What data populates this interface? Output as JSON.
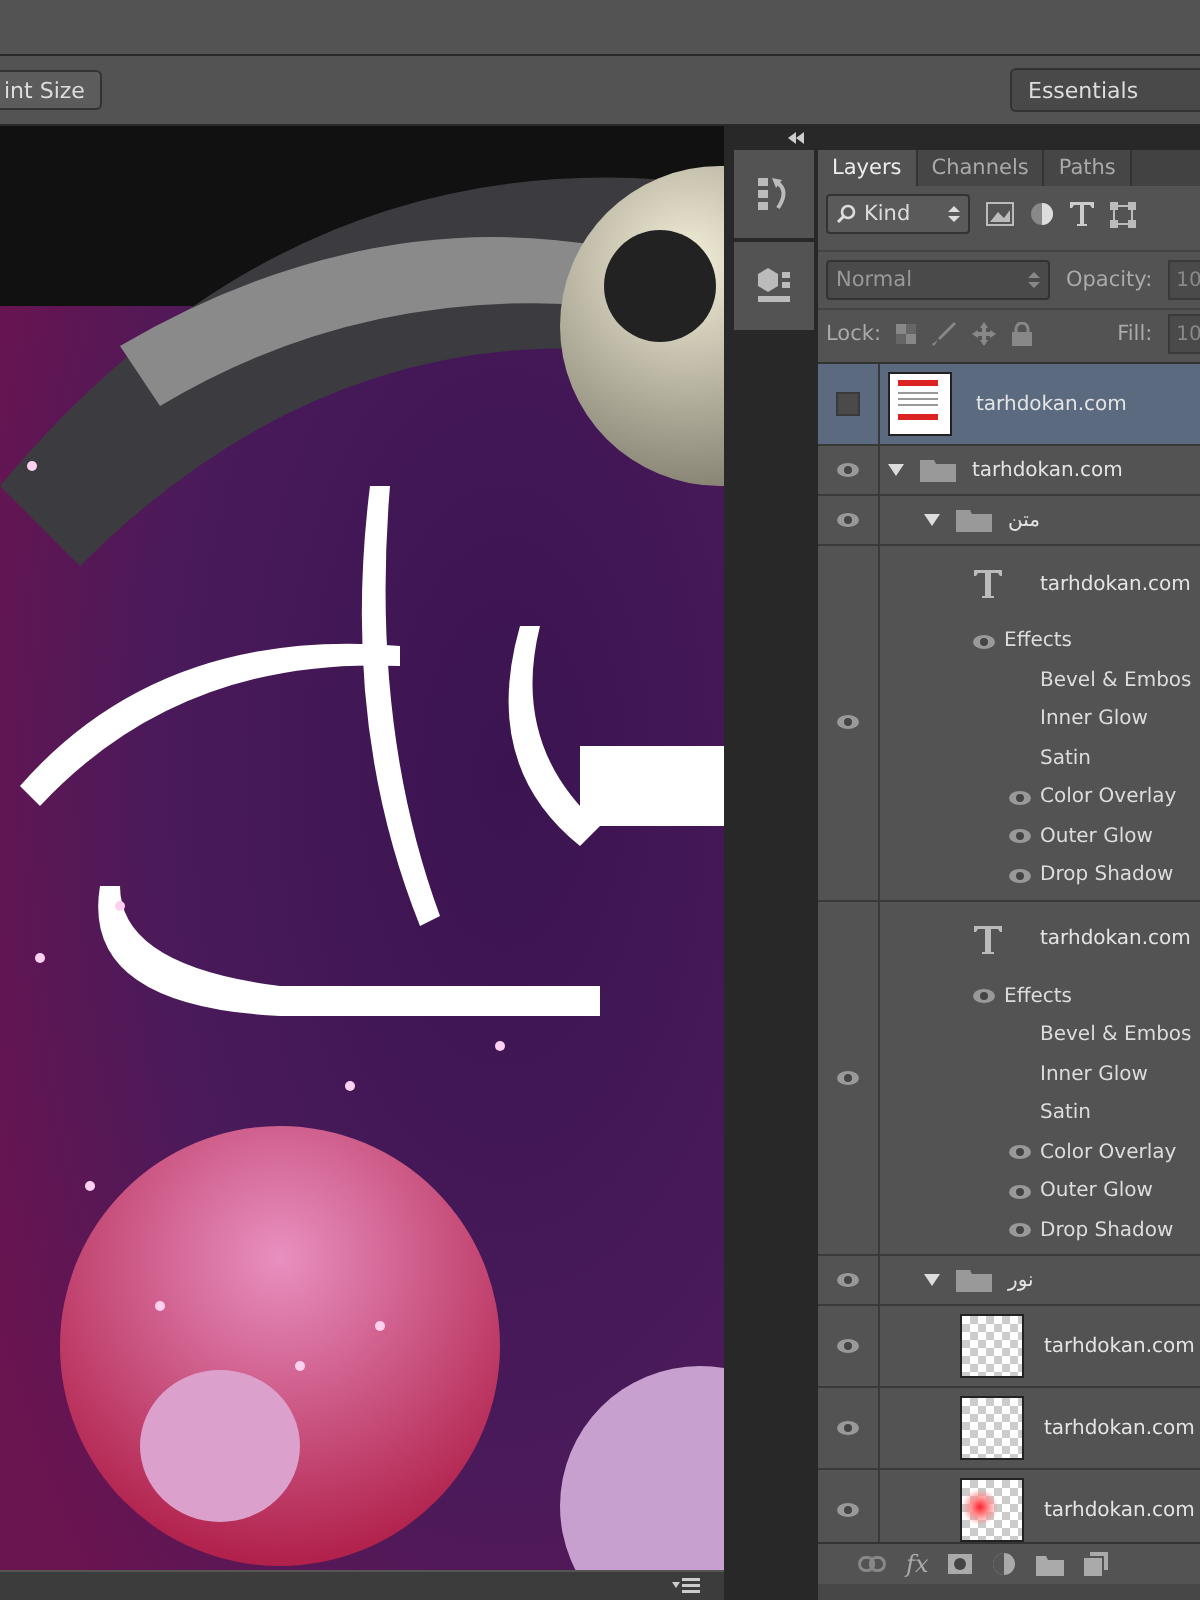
{
  "options_bar": {
    "button": "int Size",
    "workspace": "Essentials"
  },
  "layers_panel": {
    "tabs": [
      {
        "label": "Layers",
        "selected": true
      },
      {
        "label": "Channels",
        "selected": false
      },
      {
        "label": "Paths",
        "selected": false
      }
    ],
    "filter": "Kind",
    "blend_mode": "Normal",
    "opacity_label": "Opacity:",
    "opacity": "10",
    "lock_label": "Lock:",
    "fill_label": "Fill:",
    "fill": "10",
    "layers": [
      {
        "kind": "image",
        "name": "tarhdokan.com",
        "visible": false,
        "selected": true,
        "thumbnail": {
          "kind": "document"
        }
      },
      {
        "kind": "group",
        "name": "tarhdokan.com",
        "visible": true,
        "expanded": true,
        "selected": false,
        "children": [
          {
            "kind": "group",
            "name": "متن",
            "visible": true,
            "expanded": true,
            "selected": false,
            "children": [
              {
                "kind": "text",
                "name": "tarhdokan.com",
                "visible": true,
                "selected": false,
                "effects_label": "Effects",
                "effects_visible": true,
                "effects": [
                  {
                    "name": "Bevel & Embos",
                    "visible": false
                  },
                  {
                    "name": "Inner Glow",
                    "visible": false
                  },
                  {
                    "name": "Satin",
                    "visible": false
                  },
                  {
                    "name": "Color Overlay",
                    "visible": true
                  },
                  {
                    "name": "Outer Glow",
                    "visible": true
                  },
                  {
                    "name": "Drop Shadow",
                    "visible": true
                  }
                ]
              },
              {
                "kind": "text",
                "name": "tarhdokan.com",
                "visible": true,
                "selected": false,
                "effects_label": "Effects",
                "effects_visible": true,
                "effects": [
                  {
                    "name": "Bevel & Embos",
                    "visible": false
                  },
                  {
                    "name": "Inner Glow",
                    "visible": false
                  },
                  {
                    "name": "Satin",
                    "visible": false
                  },
                  {
                    "name": "Color Overlay",
                    "visible": true
                  },
                  {
                    "name": "Outer Glow",
                    "visible": true
                  },
                  {
                    "name": "Drop Shadow",
                    "visible": true
                  }
                ]
              }
            ]
          },
          {
            "kind": "group",
            "name": "نور",
            "visible": true,
            "expanded": true,
            "selected": false,
            "children": [
              {
                "kind": "image",
                "name": "tarhdokan.com",
                "visible": true,
                "selected": false,
                "thumbnail": {
                  "kind": "empty"
                }
              },
              {
                "kind": "image",
                "name": "tarhdokan.com",
                "visible": true,
                "selected": false,
                "thumbnail": {
                  "kind": "empty"
                }
              },
              {
                "kind": "image",
                "name": "tarhdokan.com",
                "visible": true,
                "selected": false,
                "thumbnail": {
                  "kind": "glow"
                }
              }
            ]
          }
        ]
      }
    ],
    "footer_fx": "fx"
  }
}
